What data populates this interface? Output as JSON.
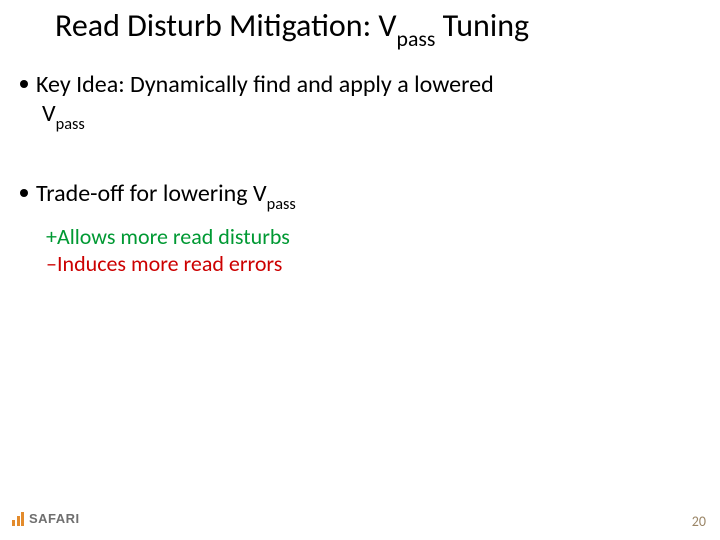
{
  "title": {
    "pre": "Read Disturb Mitigation: V",
    "sub": "pass",
    "post": " Tuning"
  },
  "bullets": {
    "b1_pre": "Key Idea: Dynamically find and apply a lowered",
    "b1_line2_pre": "V",
    "b1_line2_sub": "pass",
    "b2_pre": "Trade-off for lowering V",
    "b2_sub": "pass"
  },
  "subs": {
    "plus_sign": "+",
    "plus_text": "Allows more read disturbs",
    "minus_sign": "–",
    "minus_text": "Induces more read errors"
  },
  "logo_text": "SAFARI",
  "page_number": "20"
}
